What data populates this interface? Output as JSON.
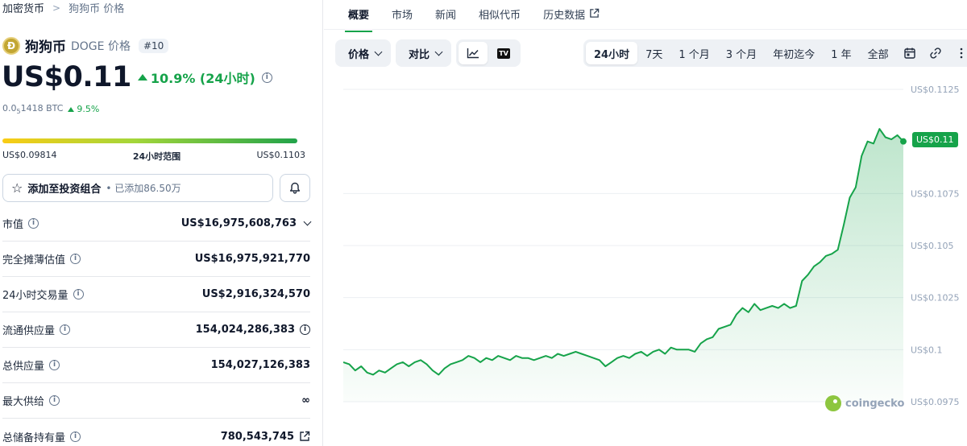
{
  "breadcrumb": {
    "root": "加密货币",
    "separator": ">",
    "current": "狗狗币 价格"
  },
  "coin": {
    "logo_glyph": "Ð",
    "name": "狗狗币",
    "symbol_label": "DOGE 价格",
    "rank": "#10",
    "price": "US$0.11",
    "change_24h": "10.9% (24小时)",
    "btc_price_prefix": "0.0",
    "btc_price_sub": "5",
    "btc_price_suffix": "1418 BTC",
    "btc_change": "9.5%",
    "range_low": "US$0.09814",
    "range_label": "24小时范围",
    "range_high": "US$0.1103",
    "range_position": 1.0
  },
  "watchlist": {
    "label": "添加至投资组合",
    "added_text": "• 已添加86.50万"
  },
  "stats": [
    {
      "label": "市值",
      "value": "US$16,975,608,763",
      "has_info": true,
      "trail": "chevron-down"
    },
    {
      "label": "完全摊薄估值",
      "value": "US$16,975,921,770",
      "has_info": true,
      "trail": ""
    },
    {
      "label": "24小时交易量",
      "value": "US$2,916,324,570",
      "has_info": true,
      "trail": ""
    },
    {
      "label": "流通供应量",
      "value": "154,024,286,383",
      "has_info": true,
      "trail": "info"
    },
    {
      "label": "总供应量",
      "value": "154,027,126,383",
      "has_info": true,
      "trail": ""
    },
    {
      "label": "最大供给",
      "value": "∞",
      "has_info": true,
      "trail": ""
    },
    {
      "label": "总储备持有量",
      "value": "780,543,745",
      "has_info": true,
      "trail": "external-link"
    }
  ],
  "tabs": [
    {
      "label": "概要",
      "active": true
    },
    {
      "label": "市场",
      "active": false
    },
    {
      "label": "新闻",
      "active": false
    },
    {
      "label": "相似代币",
      "active": false
    },
    {
      "label": "历史数据",
      "active": false,
      "external": true
    }
  ],
  "toolbar": {
    "price_dropdown": "价格",
    "compare_dropdown": "对比",
    "tv_logo_text": "TV"
  },
  "ranges": [
    {
      "label": "24小时",
      "active": true
    },
    {
      "label": "7天",
      "active": false
    },
    {
      "label": "1 个月",
      "active": false
    },
    {
      "label": "3 个月",
      "active": false
    },
    {
      "label": "年初迄今",
      "active": false
    },
    {
      "label": "1 年",
      "active": false
    },
    {
      "label": "全部",
      "active": false
    }
  ],
  "watermark": "coingecko",
  "colors": {
    "accent_green": "#16a34a",
    "text_primary": "#0f172a",
    "muted": "#64748b"
  },
  "chart_data": {
    "type": "area",
    "ylim": [
      0.0975,
      0.1125
    ],
    "yticks": [
      {
        "v": 0.1125,
        "label": "US$0.1125"
      },
      {
        "v": 0.1075,
        "label": "US$0.1075"
      },
      {
        "v": 0.105,
        "label": "US$0.105"
      },
      {
        "v": 0.1025,
        "label": "US$0.1025"
      },
      {
        "v": 0.1,
        "label": "US$0.1"
      },
      {
        "v": 0.0975,
        "label": "US$0.0975"
      }
    ],
    "current_label": "US$0.11",
    "series": [
      {
        "values": [
          0.0994,
          0.0993,
          0.099,
          0.0992,
          0.0989,
          0.0988,
          0.099,
          0.0989,
          0.0991,
          0.0993,
          0.0994,
          0.0992,
          0.0994,
          0.0995,
          0.0993,
          0.099,
          0.0988,
          0.0991,
          0.0993,
          0.0994,
          0.0995,
          0.0997,
          0.0996,
          0.0994,
          0.0996,
          0.0995,
          0.0997,
          0.0996,
          0.0995,
          0.0997,
          0.0996,
          0.0996,
          0.0995,
          0.0996,
          0.0997,
          0.0996,
          0.0998,
          0.0997,
          0.0998,
          0.0999,
          0.0998,
          0.0997,
          0.0996,
          0.0995,
          0.0992,
          0.0994,
          0.0996,
          0.0997,
          0.0996,
          0.0998,
          0.0999,
          0.0997,
          0.0999,
          0.1,
          0.0998,
          0.1001,
          0.1,
          0.1,
          0.1,
          0.0999,
          0.1003,
          0.1005,
          0.1006,
          0.101,
          0.1011,
          0.1012,
          0.1017,
          0.102,
          0.1018,
          0.1022,
          0.1019,
          0.102,
          0.1021,
          0.102,
          0.1022,
          0.102,
          0.1021,
          0.1033,
          0.1036,
          0.104,
          0.1042,
          0.1045,
          0.1046,
          0.1048,
          0.106,
          0.1073,
          0.1078,
          0.1093,
          0.11,
          0.1099,
          0.1106,
          0.1102,
          0.1101,
          0.1103,
          0.11
        ]
      }
    ]
  }
}
